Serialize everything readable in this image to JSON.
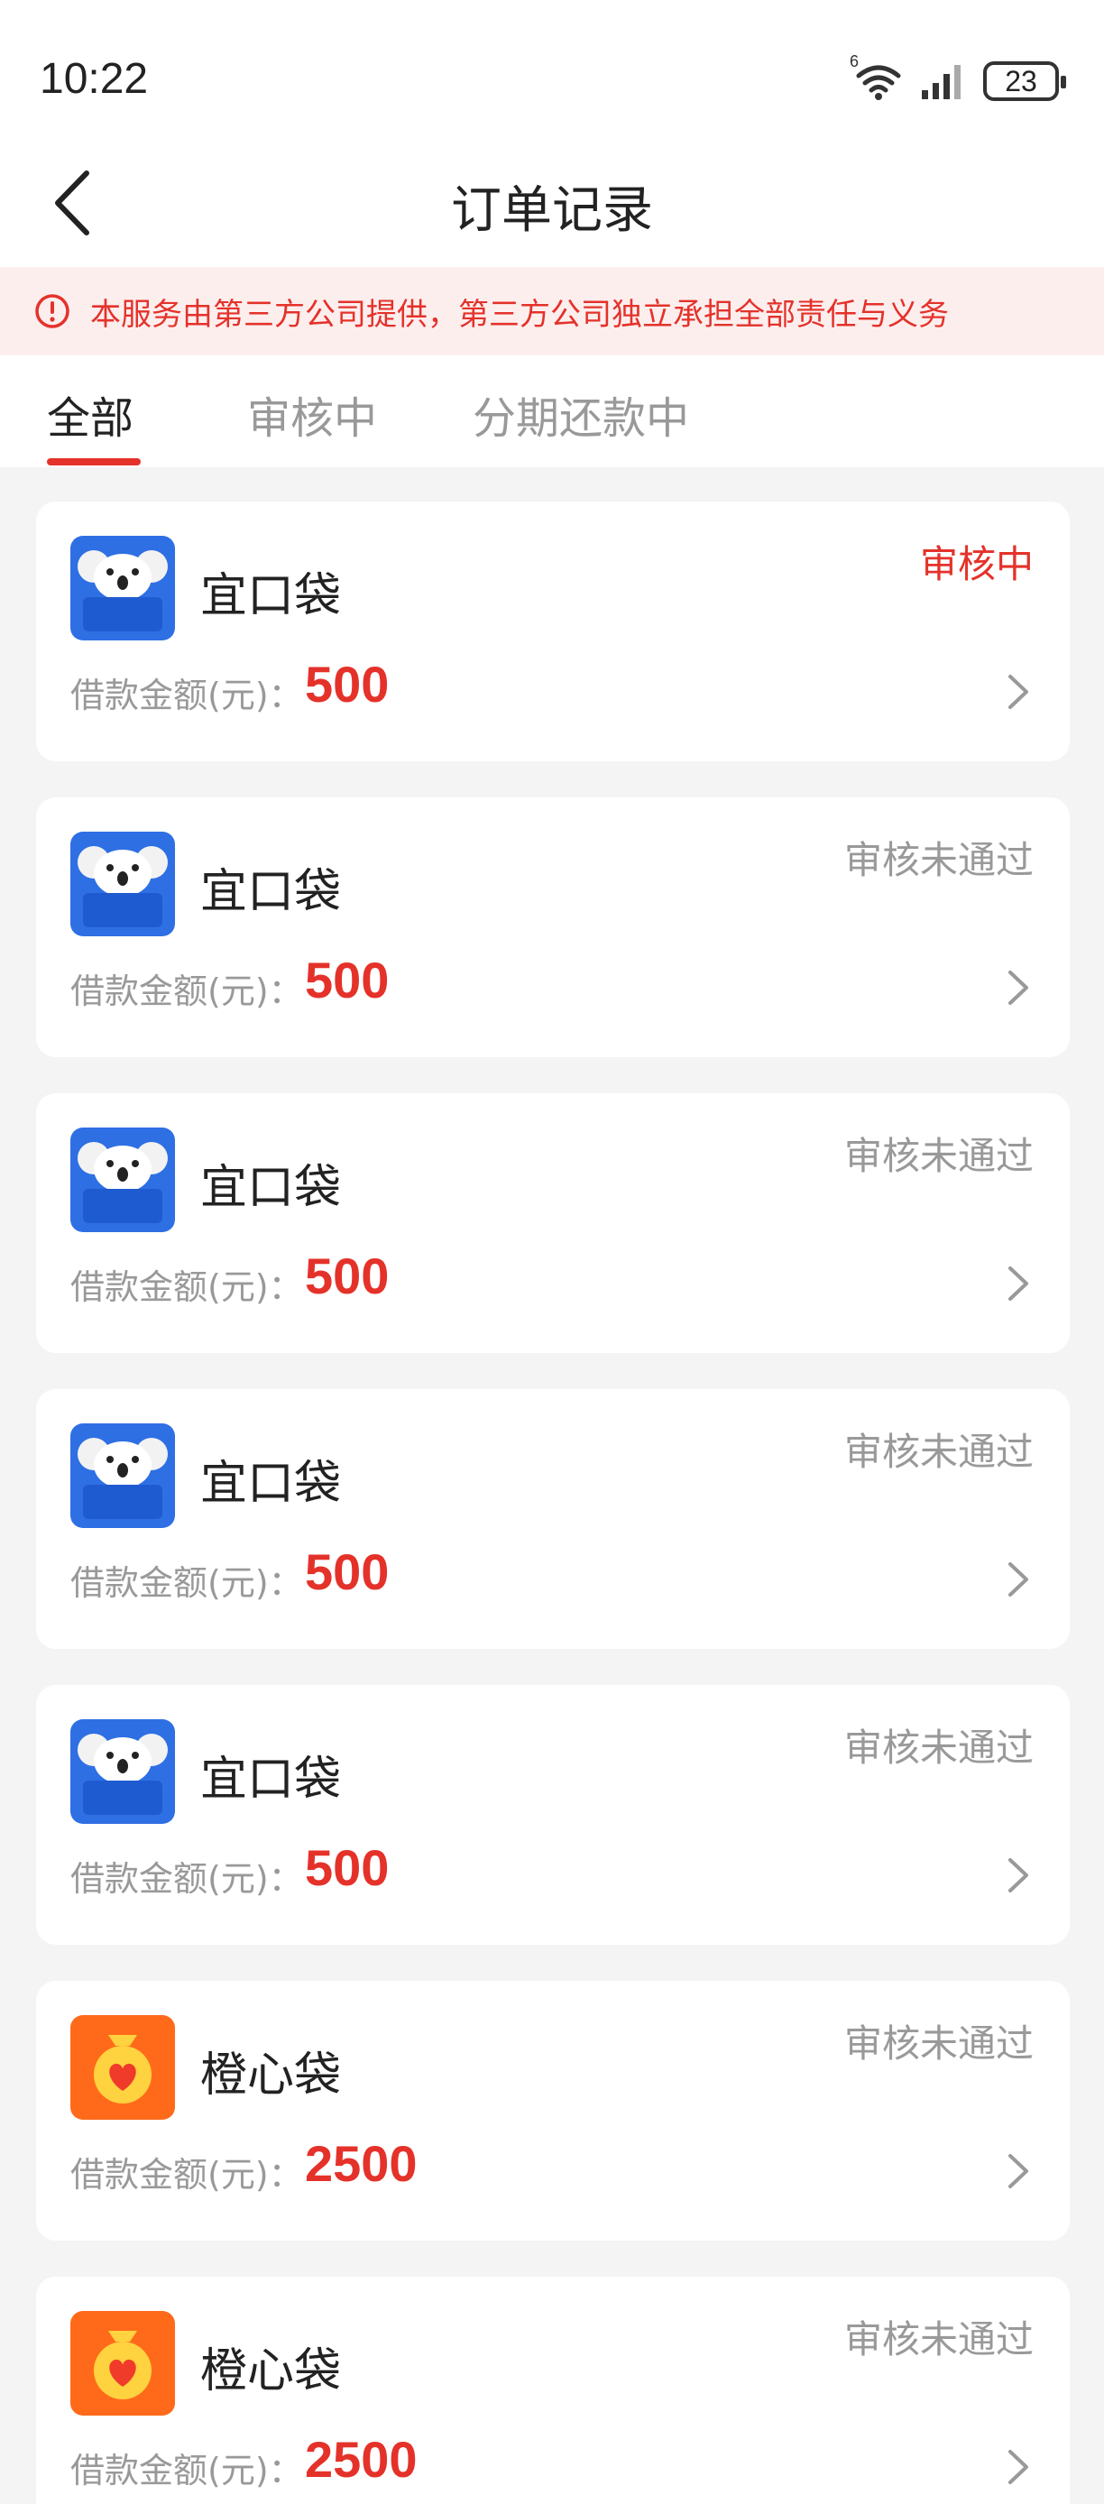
{
  "status_bar": {
    "time": "10:22",
    "network_badge": "6",
    "battery_level": "23",
    "icons": [
      "wifi-icon",
      "signal-icon",
      "battery-icon"
    ]
  },
  "header": {
    "title": "订单记录",
    "back_icon": "back-arrow-icon"
  },
  "notice": {
    "icon": "alert-circle-icon",
    "text": "本服务由第三方公司提供，第三方公司独立承担全部责任与义务"
  },
  "tabs": [
    {
      "label": "全部",
      "active": true
    },
    {
      "label": "审核中",
      "active": false
    },
    {
      "label": "分期还款中",
      "active": false
    }
  ],
  "orders": [
    {
      "name": "宜口袋",
      "status": "审核中",
      "status_type": "pending",
      "amount_label": "借款金额(元)：",
      "amount": "500",
      "logo": "koala-logo"
    },
    {
      "name": "宜口袋",
      "status": "审核未通过",
      "status_type": "rejected",
      "amount_label": "借款金额(元)：",
      "amount": "500",
      "logo": "koala-logo"
    },
    {
      "name": "宜口袋",
      "status": "审核未通过",
      "status_type": "rejected",
      "amount_label": "借款金额(元)：",
      "amount": "500",
      "logo": "koala-logo"
    },
    {
      "name": "宜口袋",
      "status": "审核未通过",
      "status_type": "rejected",
      "amount_label": "借款金额(元)：",
      "amount": "500",
      "logo": "koala-logo"
    },
    {
      "name": "宜口袋",
      "status": "审核未通过",
      "status_type": "rejected",
      "amount_label": "借款金额(元)：",
      "amount": "500",
      "logo": "koala-logo"
    },
    {
      "name": "橙心袋",
      "status": "审核未通过",
      "status_type": "rejected",
      "amount_label": "借款金额(元)：",
      "amount": "2500",
      "logo": "money-bag-heart-logo"
    },
    {
      "name": "橙心袋",
      "status": "审核未通过",
      "status_type": "rejected",
      "amount_label": "借款金额(元)：",
      "amount": "2500",
      "logo": "money-bag-heart-logo"
    }
  ],
  "colors": {
    "accent": "#e4322a",
    "muted_text": "#999999",
    "notice_bg": "#fdeeee",
    "page_bg": "#f4f4f4",
    "koala_logo_bg": "#2f6fe4",
    "orange_logo_bg": "#ff6a1a"
  }
}
